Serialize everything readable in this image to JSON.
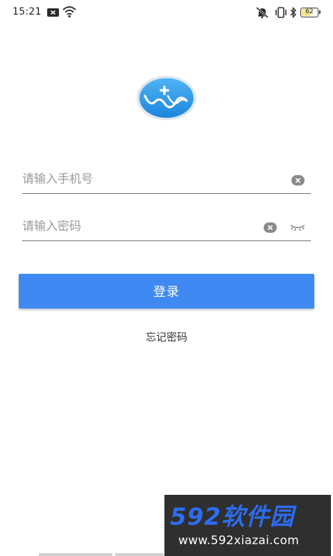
{
  "status_bar": {
    "time": "15:21",
    "battery_level": "62",
    "battery_fraction": 0.62,
    "icons": [
      "notification-icon",
      "wifi-icon",
      "mute-icon",
      "vibrate-icon",
      "bluetooth-icon",
      "battery-icon"
    ]
  },
  "logo": {
    "icon": "app-logo-icon",
    "color": "#2f9ae8"
  },
  "login_form": {
    "phone_placeholder": "请输入手机号",
    "phone_value": "",
    "password_placeholder": "请输入密码",
    "password_value": "",
    "login_label": "登录",
    "forgot_label": "忘记密码"
  },
  "watermark": {
    "title": "592软件园",
    "url": "www.592xiazai.com"
  },
  "colors": {
    "accent": "#3f8af2",
    "text": "#333333",
    "placeholder": "#9a9a9a"
  }
}
